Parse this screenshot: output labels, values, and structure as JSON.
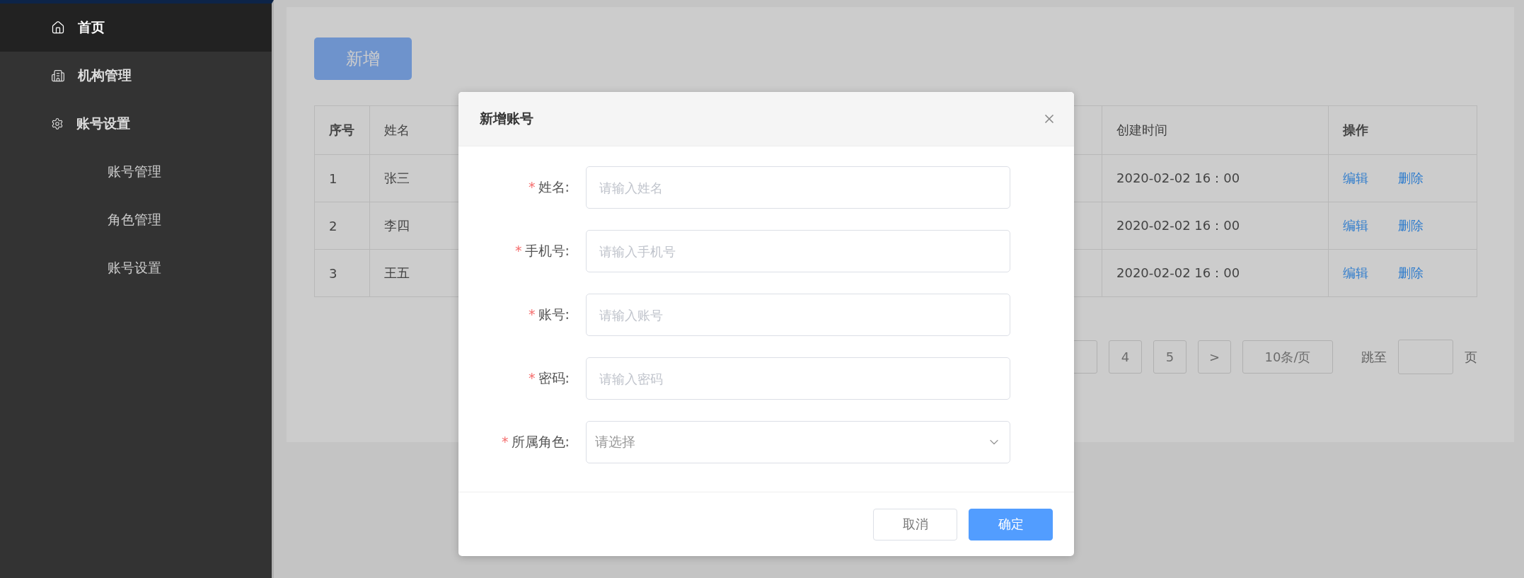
{
  "sidebar": {
    "items": [
      {
        "label": "首页",
        "selected": true
      },
      {
        "label": "机构管理",
        "selected": false
      },
      {
        "label": "账号设置",
        "selected": false,
        "children": [
          {
            "label": "账号管理",
            "selected": false
          },
          {
            "label": "角色管理",
            "selected": false
          },
          {
            "label": "账号设置",
            "selected": false
          }
        ]
      }
    ]
  },
  "add_button": "新增",
  "table": {
    "columns": [
      "序号",
      "姓名",
      "创建时间",
      "操作"
    ],
    "rows": [
      {
        "cells": [
          "1",
          "张三",
          "2020-02-02 16：00"
        ],
        "actions": [
          "编辑",
          "删除"
        ]
      },
      {
        "cells": [
          "2",
          "李四",
          "2020-02-02 16：00"
        ],
        "actions": [
          "编辑",
          "删除"
        ]
      },
      {
        "cells": [
          "3",
          "王五",
          "2020-02-02 16：00"
        ],
        "actions": [
          "编辑",
          "删除"
        ]
      }
    ]
  },
  "pagination": {
    "pages": [
      {
        "label": "4",
        "selected": false
      },
      {
        "label": "5",
        "selected": false
      }
    ],
    "next": ">",
    "page_size": "10条/页",
    "jump_label": "跳至",
    "jump_suffix": "页"
  },
  "dialog": {
    "title": "新增账号",
    "required_mark": "*",
    "fields": [
      {
        "label": "姓名:",
        "required": true,
        "kind": "input",
        "placeholder": "请输入姓名"
      },
      {
        "label": "手机号:",
        "required": true,
        "kind": "input",
        "placeholder": "请输入手机号"
      },
      {
        "label": "账号:",
        "required": true,
        "kind": "input",
        "placeholder": "请输入账号"
      },
      {
        "label": "密码:",
        "required": true,
        "kind": "input",
        "placeholder": "请输入密码"
      },
      {
        "label": "所属角色:",
        "required": true,
        "kind": "select",
        "placeholder": "请选择"
      }
    ],
    "buttons": [
      {
        "label": "取消",
        "primary": false
      },
      {
        "label": "确定",
        "primary": true
      }
    ]
  }
}
